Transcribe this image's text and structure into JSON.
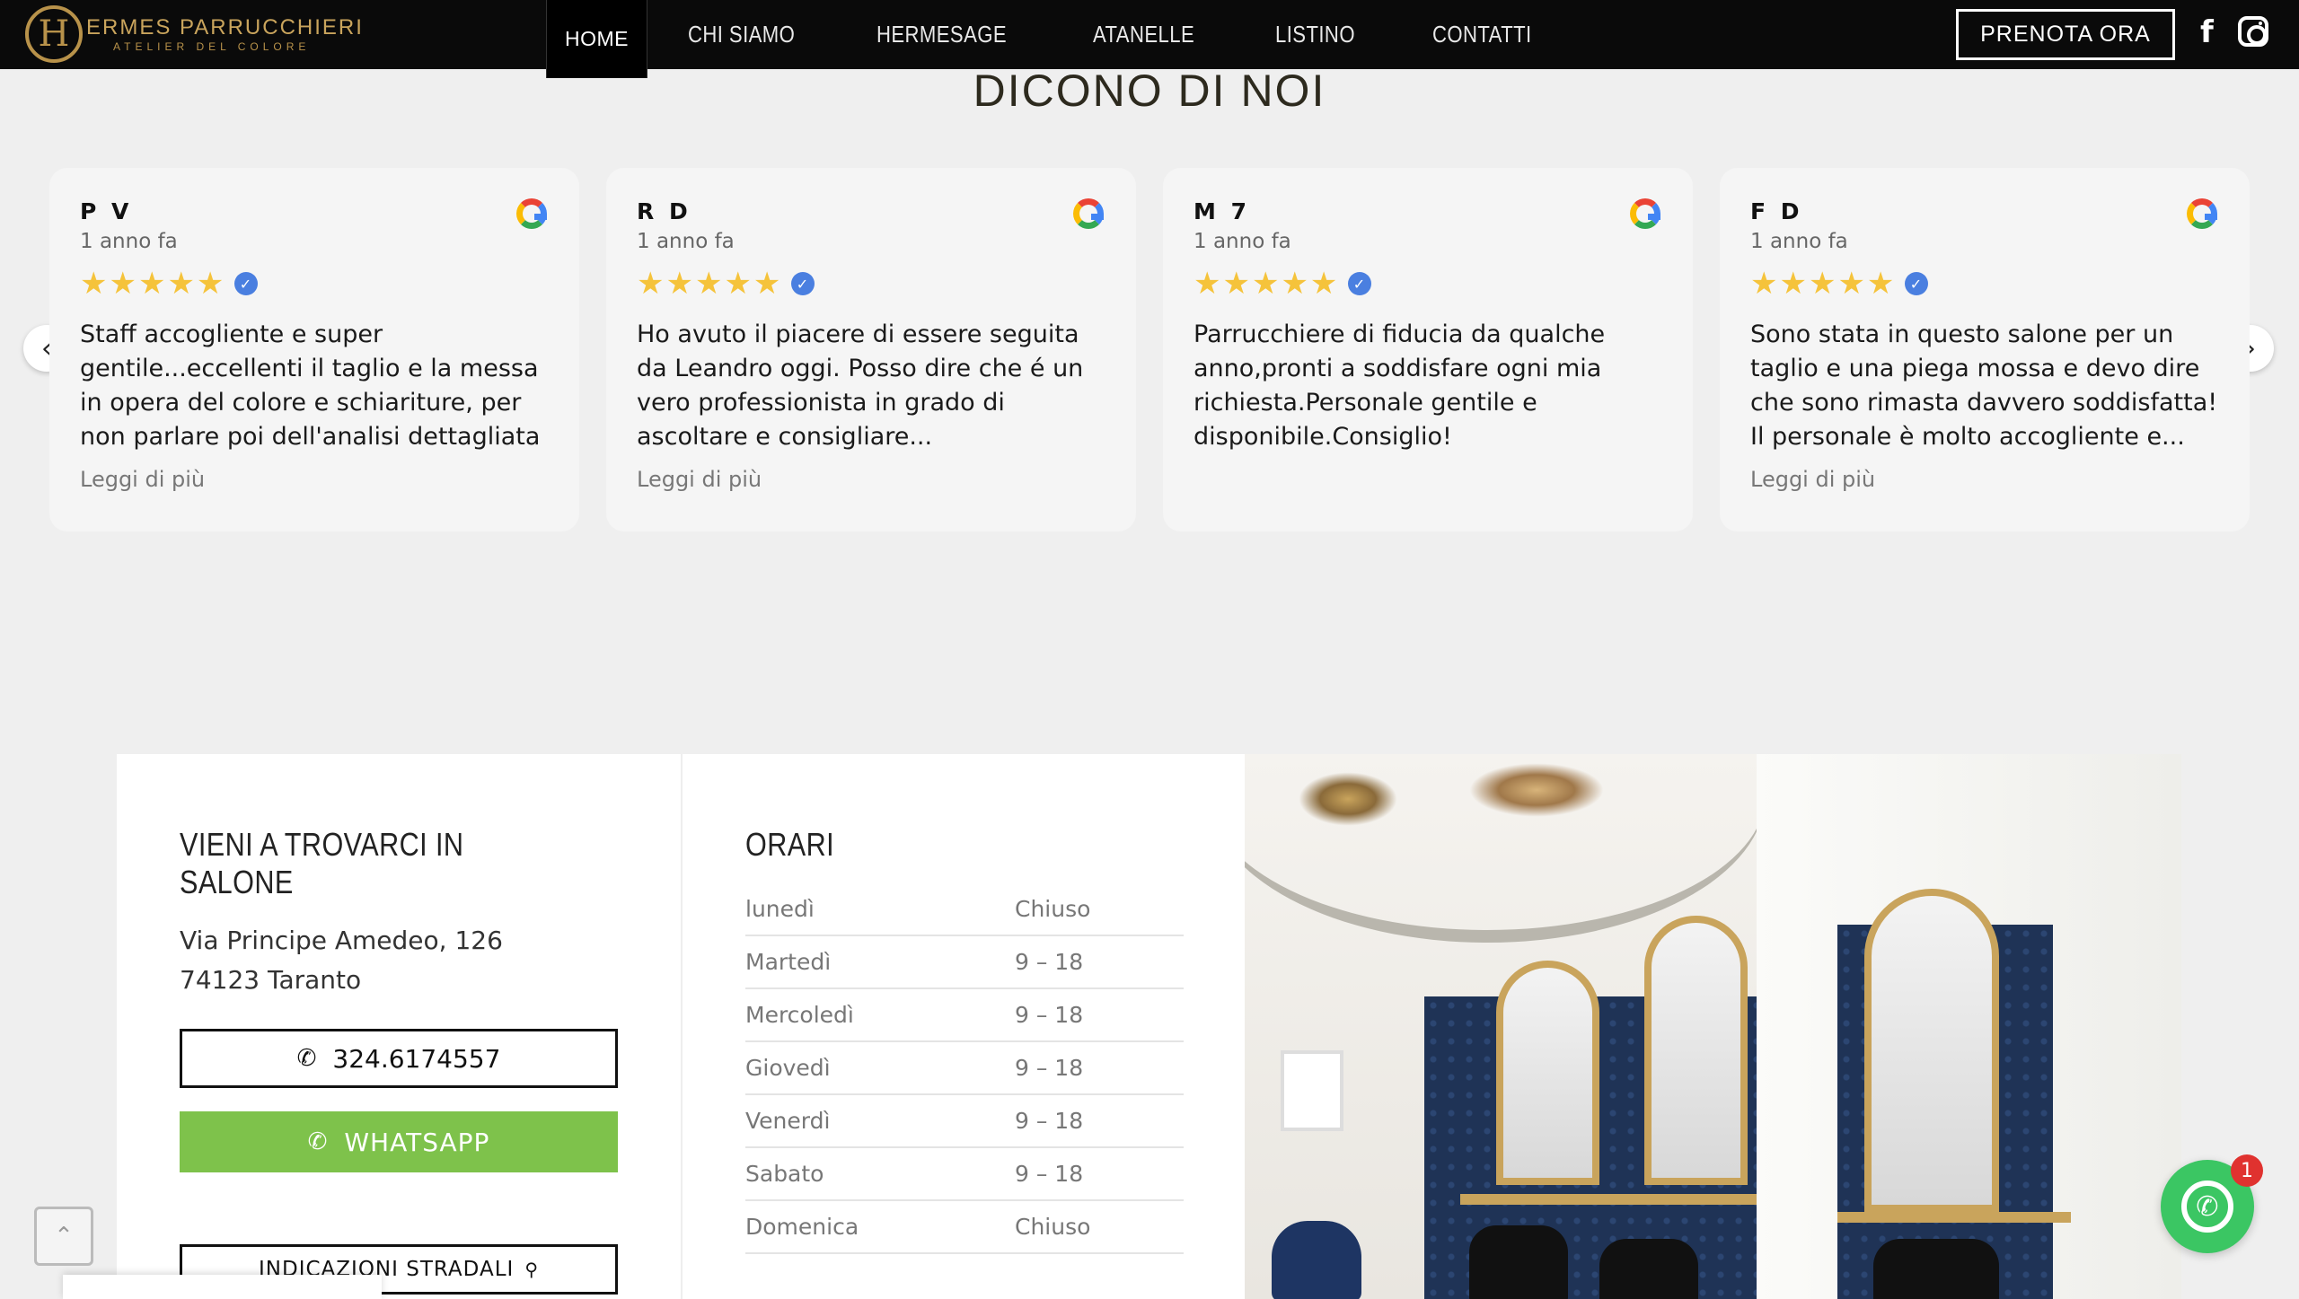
{
  "header": {
    "logo_name": "ERMES PARRUCCHIERI",
    "logo_sub": "ATELIER DEL COLORE",
    "nav": [
      "HOME",
      "CHI SIAMO",
      "HERMESAGE",
      "ATANELLE",
      "LISTINO",
      "CONTATTI"
    ],
    "book_label": "PRENOTA ORA"
  },
  "reviews": {
    "title": "DICONO DI NOI",
    "stars": "★★★★★",
    "items": [
      {
        "name": "P V",
        "time": "1 anno fa",
        "text": "Staff accogliente e super gentile...eccellenti il taglio e la messa in opera del colore e schiariture, per non parlare poi dell'analisi dettagliata del...",
        "more": "Leggi di più"
      },
      {
        "name": "R D",
        "time": "1 anno fa",
        "text": "Ho avuto il piacere di essere seguita da Leandro oggi. Posso dire che é un vero professionista in grado di ascoltare e consigliare...",
        "more": "Leggi di più"
      },
      {
        "name": "M 7",
        "time": "1 anno fa",
        "text": "Parrucchiere di fiducia da qualche anno,pronti a soddisfare ogni mia richiesta.Personale gentile e disponibile.Consiglio!",
        "more": ""
      },
      {
        "name": "F D",
        "time": "1 anno fa",
        "text": "Sono stata in questo salone per un taglio e una piega mossa e devo dire che sono rimasta davvero soddisfatta! Il personale è molto accogliente e...",
        "more": "Leggi di più"
      }
    ]
  },
  "contact": {
    "title": "VIENI A TROVARCI IN SALONE",
    "address_line1": "Via Principe Amedeo, 126",
    "address_line2": "74123 Taranto",
    "phone_label": "324.6174557",
    "whatsapp_label": "WHATSAPP",
    "directions_label": "INDICAZIONI STRADALI"
  },
  "hours": {
    "title": "ORARI",
    "rows": [
      {
        "day": "lunedì",
        "time": "Chiuso"
      },
      {
        "day": "Martedì",
        "time": "9 – 18"
      },
      {
        "day": "Mercoledì",
        "time": "9 – 18"
      },
      {
        "day": "Giovedì",
        "time": "9 – 18"
      },
      {
        "day": "Venerdì",
        "time": "9 – 18"
      },
      {
        "day": "Sabato",
        "time": "9 – 18"
      },
      {
        "day": "Domenica",
        "time": "Chiuso"
      }
    ]
  },
  "floating": {
    "whatsapp_badge": "1"
  }
}
